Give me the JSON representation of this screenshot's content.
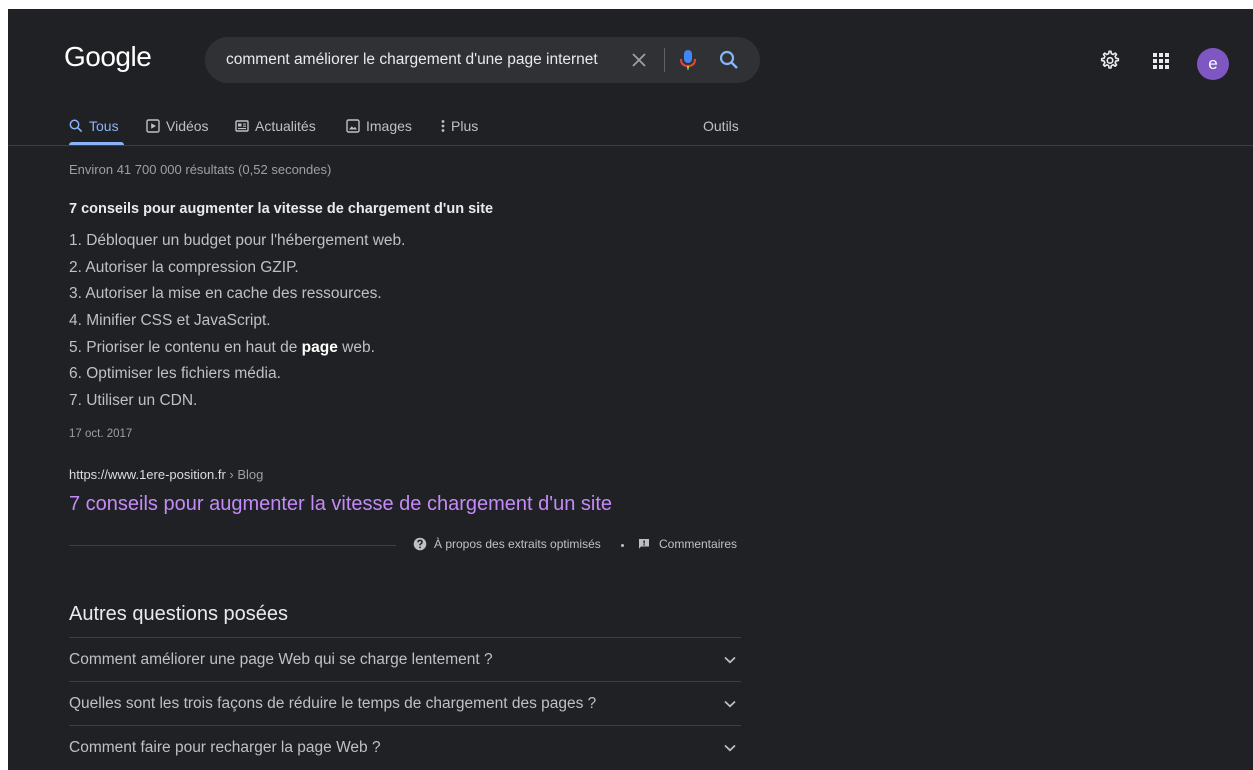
{
  "header": {
    "logo": "Google",
    "search_query": "comment améliorer le chargement d'une page internet",
    "avatar_letter": "e",
    "avatar_color": "#7e57c2"
  },
  "tabs": {
    "all": "Tous",
    "videos": "Vidéos",
    "news": "Actualités",
    "images": "Images",
    "more": "Plus",
    "tools": "Outils",
    "active": "Tous",
    "accent_color": "#8ab4f8"
  },
  "results": {
    "stats": "Environ 41 700 000 résultats (0,52 secondes)",
    "featured_title": "7 conseils pour augmenter la vitesse de chargement d'un site",
    "list": [
      {
        "text": "1. Débloquer un budget pour l'hébergement web."
      },
      {
        "text": "2. Autoriser la compression GZIP."
      },
      {
        "text": "3. Autoriser la mise en cache des ressources."
      },
      {
        "text": "4. Minifier CSS et JavaScript."
      },
      {
        "before": "5. Prioriser le contenu en haut de ",
        "bold": "page",
        "after": " web."
      },
      {
        "text": "6. Optimiser les fichiers média."
      },
      {
        "text": "7. Utiliser un CDN."
      }
    ],
    "date": "17 oct. 2017",
    "url_domain": "https://www.1ere-position.fr",
    "url_crumb": " › Blog",
    "title": "7 conseils pour augmenter la vitesse de chargement d'un site",
    "title_color": "#c58af9",
    "about_featured": "À propos des extraits optimisés",
    "feedback": "Commentaires"
  },
  "paa": {
    "heading": "Autres questions posées",
    "questions": [
      "Comment améliorer une page Web qui se charge lentement ?",
      "Quelles sont les trois façons de réduire le temps de chargement des pages ?",
      "Comment faire pour recharger la page Web ?"
    ]
  },
  "icons": {
    "search": "search-icon",
    "clear": "close-icon",
    "mic": "microphone-icon",
    "lens": "magnifier-icon",
    "settings": "gear-icon",
    "apps": "grid-icon",
    "video": "play-icon",
    "news": "newspaper-icon",
    "images": "image-icon",
    "more": "vertical-dots-icon",
    "help": "question-circle-icon",
    "feedback": "comment-icon",
    "expand": "chevron-down-icon"
  }
}
